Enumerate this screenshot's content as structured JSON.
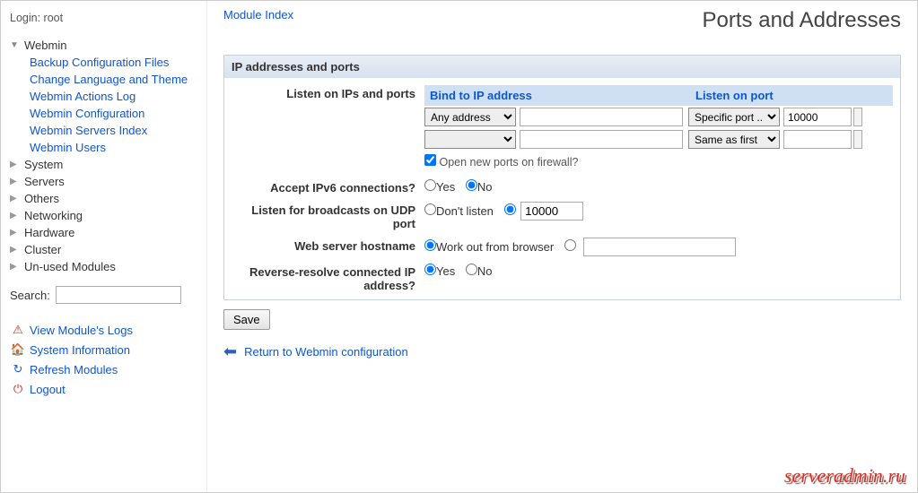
{
  "login": {
    "label": "Login:",
    "user": "root"
  },
  "nav": {
    "webmin": "Webmin",
    "subs": {
      "backup": "Backup Configuration Files",
      "lang": "Change Language and Theme",
      "actions": "Webmin Actions Log",
      "config": "Webmin Configuration",
      "servers": "Webmin Servers Index",
      "users": "Webmin Users"
    },
    "system": "System",
    "servers_cat": "Servers",
    "others": "Others",
    "networking": "Networking",
    "hardware": "Hardware",
    "cluster": "Cluster",
    "unused": "Un-used Modules"
  },
  "search": {
    "label": "Search:",
    "value": ""
  },
  "bottom": {
    "logs": "View Module's Logs",
    "sysinfo": "System Information",
    "refresh": "Refresh Modules",
    "logout": "Logout"
  },
  "main": {
    "module_index": "Module Index",
    "title": "Ports and Addresses",
    "panel_title": "IP addresses and ports",
    "labels": {
      "listen_ips": "Listen on IPs and ports",
      "bind_header": "Bind to IP address",
      "port_header": "Listen on port",
      "open_firewall": "Open new ports on firewall?",
      "accept_ipv6": "Accept IPv6 connections?",
      "yes": "Yes",
      "no": "No",
      "udp_broadcast": "Listen for broadcasts on UDP port",
      "dont_listen": "Don't listen",
      "udp_port": "10000",
      "hostname": "Web server hostname",
      "workout": "Work out from browser",
      "reverse": "Reverse-resolve connected IP address?"
    },
    "rows": [
      {
        "bind_sel": "Any address",
        "bind_val": "",
        "port_sel": "Specific port ..",
        "port_val": "10000"
      },
      {
        "bind_sel": "",
        "bind_val": "",
        "port_sel": "Same as first",
        "port_val": ""
      }
    ],
    "save": "Save",
    "return": "Return to Webmin configuration"
  },
  "watermark": "serveradmin.ru"
}
